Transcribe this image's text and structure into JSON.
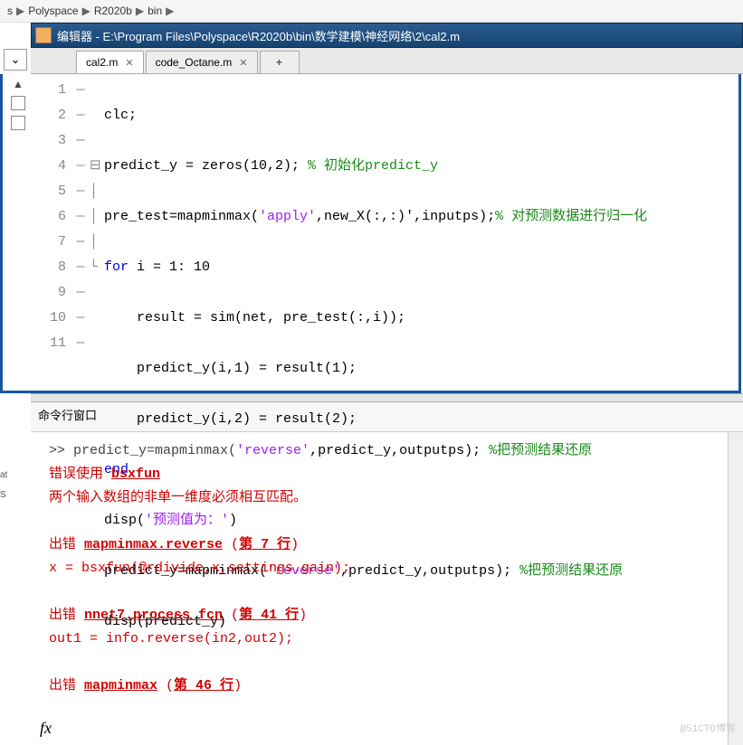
{
  "breadcrumb": {
    "items": [
      "s",
      "Polyspace",
      "R2020b",
      "bin"
    ],
    "sep": "▶"
  },
  "titlebar": {
    "text": "编辑器 - E:\\Program Files\\Polyspace\\R2020b\\bin\\数学建模\\神经网络\\2\\cal2.m"
  },
  "tabs": {
    "t1": "cal2.m",
    "t2": "code_Octane.m",
    "plus": "+",
    "close": "✕"
  },
  "code": {
    "l1": {
      "n": "1",
      "t": "clc;"
    },
    "l2": {
      "n": "2",
      "a": "predict_y = zeros(10,2); ",
      "c": "% 初始化predict_y"
    },
    "l3": {
      "n": "3",
      "a": "pre_test=mapminmax(",
      "s": "'apply'",
      "b": ",new_X(:,:)',inputps);",
      "c": "% 对预测数据进行归一化"
    },
    "l4": {
      "n": "4",
      "k": "for",
      "a": " i = 1: 10"
    },
    "l5": {
      "n": "5",
      "a": "    result = sim(net, pre_test(:,i));"
    },
    "l6": {
      "n": "6",
      "a": "    predict_y(i,1) = result(1);"
    },
    "l7": {
      "n": "7",
      "a": "    predict_y(i,2) = result(2);"
    },
    "l8": {
      "n": "8",
      "k": "end"
    },
    "l9": {
      "n": "9",
      "a": "disp(",
      "s": "'预测值为：'",
      "b": ")"
    },
    "l10": {
      "n": "10",
      "a": "predict_y=mapminmax(",
      "s": "'reverse'",
      "b": ",predict_y,outputps); ",
      "c": "%把预测结果还原"
    },
    "l11": {
      "n": "11",
      "a": "disp(predict_y)"
    }
  },
  "cw": {
    "title": "命令行窗口",
    "l1a": ">> predict_y=mapminmax(",
    "l1s": "'reverse'",
    "l1b": ",predict_y,outputps); ",
    "l1c": "%把预测结果还原",
    "e1a": "错误使用 ",
    "e1b": "bsxfun",
    "e2": "两个输入数组的非单一维度必须相互匹配。",
    "e3a": "出错 ",
    "e3b": "mapminmax.reverse",
    "e3c": " (",
    "e3d": "第 7 行",
    "e3e": ")",
    "e4": "  x = bsxfun(@rdivide,x,settings.gain);",
    "e5a": "出错 ",
    "e5b": "nnet7.process_fcn",
    "e5c": " (",
    "e5d": "第 41 行",
    "e5e": ")",
    "e6": "      out1 = info.reverse(in2,out2);",
    "e7a": "出错 ",
    "e7b": "mapminmax",
    "e7c": " (",
    "e7d": "第 46 行",
    "e7e": ")"
  },
  "fx": "fx",
  "side": {
    "a": "at",
    "b": "S"
  },
  "wm": "@51CTO博客"
}
